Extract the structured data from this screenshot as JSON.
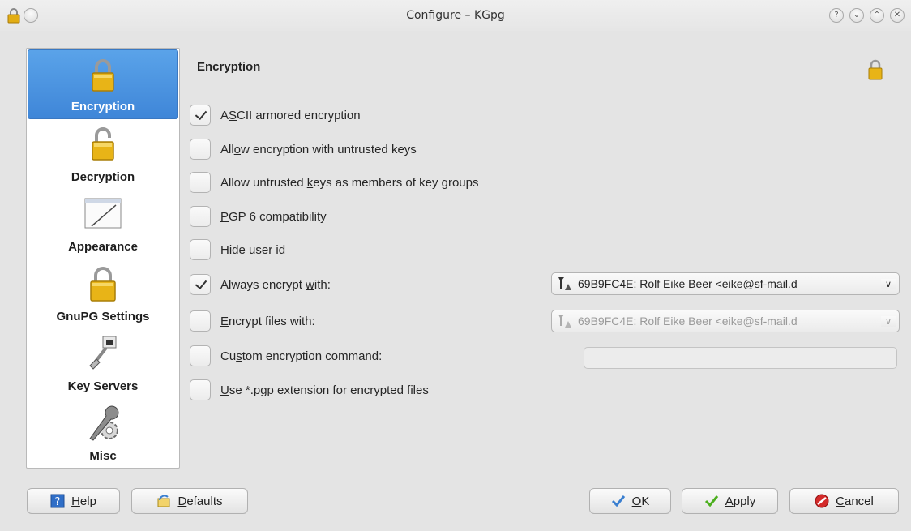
{
  "window": {
    "title": "Configure – KGpg",
    "controls": [
      "help-icon",
      "minimize-icon",
      "maximize-icon",
      "close-icon"
    ],
    "control_glyphs": {
      "help": "?",
      "minimize": "⌄",
      "maximize": "⌃",
      "close": "✕"
    }
  },
  "sidebar": {
    "items": [
      {
        "label": "Encryption",
        "icon": "lock-closed-icon",
        "selected": true
      },
      {
        "label": "Decryption",
        "icon": "lock-open-icon",
        "selected": false
      },
      {
        "label": "Appearance",
        "icon": "window-pen-icon",
        "selected": false
      },
      {
        "label": "GnuPG Settings",
        "icon": "lock-closed-icon",
        "selected": false
      },
      {
        "label": "Key Servers",
        "icon": "network-plug-icon",
        "selected": false
      },
      {
        "label": "Misc",
        "icon": "wrench-gear-icon",
        "selected": false
      }
    ]
  },
  "main": {
    "section_title": "Encryption",
    "options": [
      {
        "pre": "A",
        "acc": "S",
        "post": "CII armored encryption",
        "checked": true
      },
      {
        "pre": "All",
        "acc": "o",
        "post": "w encryption with untrusted keys",
        "checked": false
      },
      {
        "pre": "Allow untrusted ",
        "acc": "k",
        "post": "eys as members of key groups",
        "checked": false
      },
      {
        "pre": "",
        "acc": "P",
        "post": "GP 6 compatibility",
        "checked": false
      },
      {
        "pre": "Hide user ",
        "acc": "i",
        "post": "d",
        "checked": false
      },
      {
        "pre": "Always encrypt ",
        "acc": "w",
        "post": "ith:",
        "checked": true
      },
      {
        "pre": "",
        "acc": "E",
        "post": "ncrypt files with:",
        "checked": false
      },
      {
        "pre": "Cu",
        "acc": "s",
        "post": "tom encryption command:",
        "checked": false
      },
      {
        "pre": "",
        "acc": "U",
        "post": "se *.pgp extension for encrypted files",
        "checked": false
      }
    ],
    "always_encrypt_combo": {
      "value": "69B9FC4E: Rolf Eike Beer <eike@sf-mail.d",
      "enabled": true
    },
    "encrypt_files_combo": {
      "value": "69B9FC4E: Rolf Eike Beer <eike@sf-mail.d",
      "enabled": false
    },
    "custom_command_value": ""
  },
  "buttons": {
    "help": {
      "acc": "H",
      "post": "elp"
    },
    "defaults": {
      "acc": "D",
      "post": "efaults"
    },
    "ok": {
      "acc": "O",
      "post": "K"
    },
    "apply": {
      "acc": "A",
      "post": "pply"
    },
    "cancel": {
      "acc": "C",
      "post": "ancel"
    }
  },
  "colors": {
    "selection": "#4a94e0",
    "lock_gold": "#e8b417",
    "ok_check": "#3a7fd0",
    "apply_check": "#4caf1e",
    "cancel_red": "#d42a2a"
  }
}
